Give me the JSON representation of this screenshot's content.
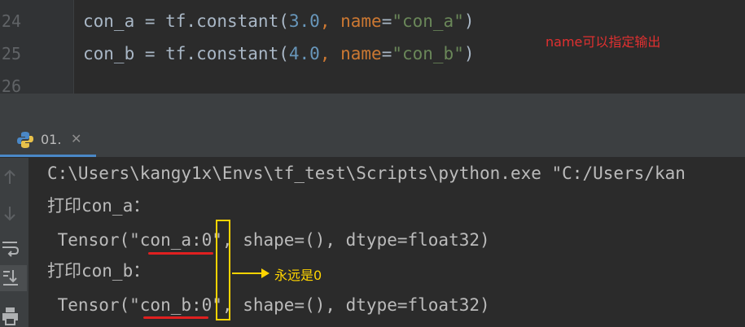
{
  "editor": {
    "line_numbers": [
      "24",
      "25",
      "26"
    ],
    "lines": [
      {
        "name": "con_a",
        "op": " = tf.constant(",
        "value": "3.0",
        "sep": ", ",
        "kw": "name",
        "eq": "=",
        "str": "\"con_a\"",
        "close": ")"
      },
      {
        "name": "con_b",
        "op": " = tf.constant(",
        "value": "4.0",
        "sep": ", ",
        "kw": "name",
        "eq": "=",
        "str": "\"con_b\"",
        "close": ")"
      }
    ],
    "annotation": "name可以指定输出"
  },
  "run_tab": {
    "label": "01.",
    "close": "✕",
    "icon": "python-icon"
  },
  "sidebar": {
    "icons": [
      "arrow-up-icon",
      "arrow-down-icon",
      "soft-wrap-icon",
      "scroll-to-end-icon",
      "print-icon"
    ]
  },
  "console": {
    "lines": [
      "C:\\Users\\kangy1x\\Envs\\tf_test\\Scripts\\python.exe \"C:/Users/kan",
      "打印con_a：",
      " Tensor(\"con_a:0\", shape=(), dtype=float32)",
      "打印con_b：",
      " Tensor(\"con_b:0\", shape=(), dtype=float32)"
    ],
    "annotation": "永远是0"
  },
  "colors": {
    "editor_bg": "#2b2b2b",
    "number": "#6897bb",
    "keyword": "#cc7832",
    "string": "#6a8759",
    "annotation_red": "#e03030",
    "annotation_yellow": "#ffd400"
  }
}
